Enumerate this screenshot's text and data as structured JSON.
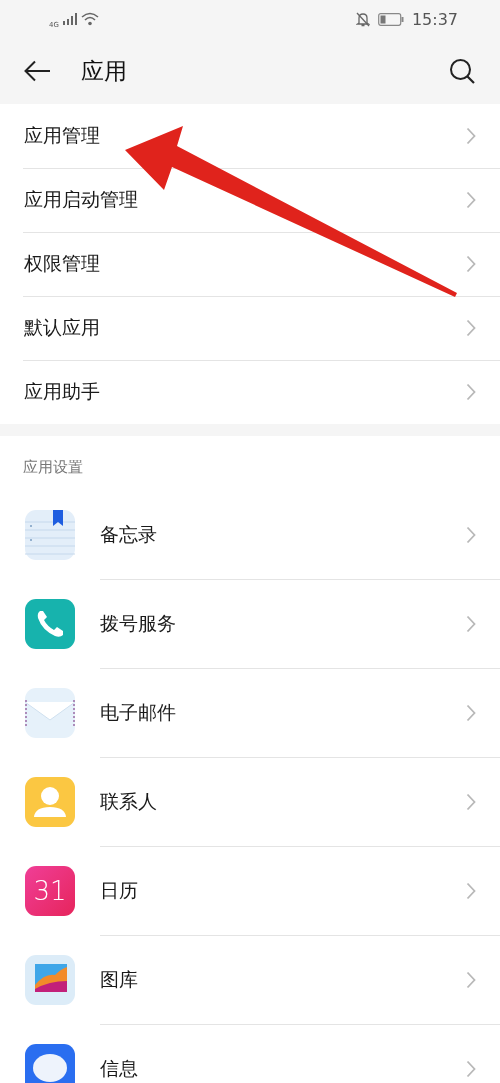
{
  "status_bar": {
    "network": "4G",
    "time": "15:37"
  },
  "header": {
    "title": "应用"
  },
  "menu": [
    {
      "label": "应用管理"
    },
    {
      "label": "应用启动管理"
    },
    {
      "label": "权限管理"
    },
    {
      "label": "默认应用"
    },
    {
      "label": "应用助手"
    }
  ],
  "section": {
    "title": "应用设置",
    "apps": [
      {
        "kind": "memo",
        "label": "备忘录"
      },
      {
        "kind": "phone",
        "label": "拨号服务"
      },
      {
        "kind": "mail",
        "label": "电子邮件"
      },
      {
        "kind": "contacts",
        "label": "联系人"
      },
      {
        "kind": "calendar",
        "label": "日历",
        "icon_text": "31"
      },
      {
        "kind": "gallery",
        "label": "图库"
      },
      {
        "kind": "messages",
        "label": "信息"
      }
    ]
  }
}
